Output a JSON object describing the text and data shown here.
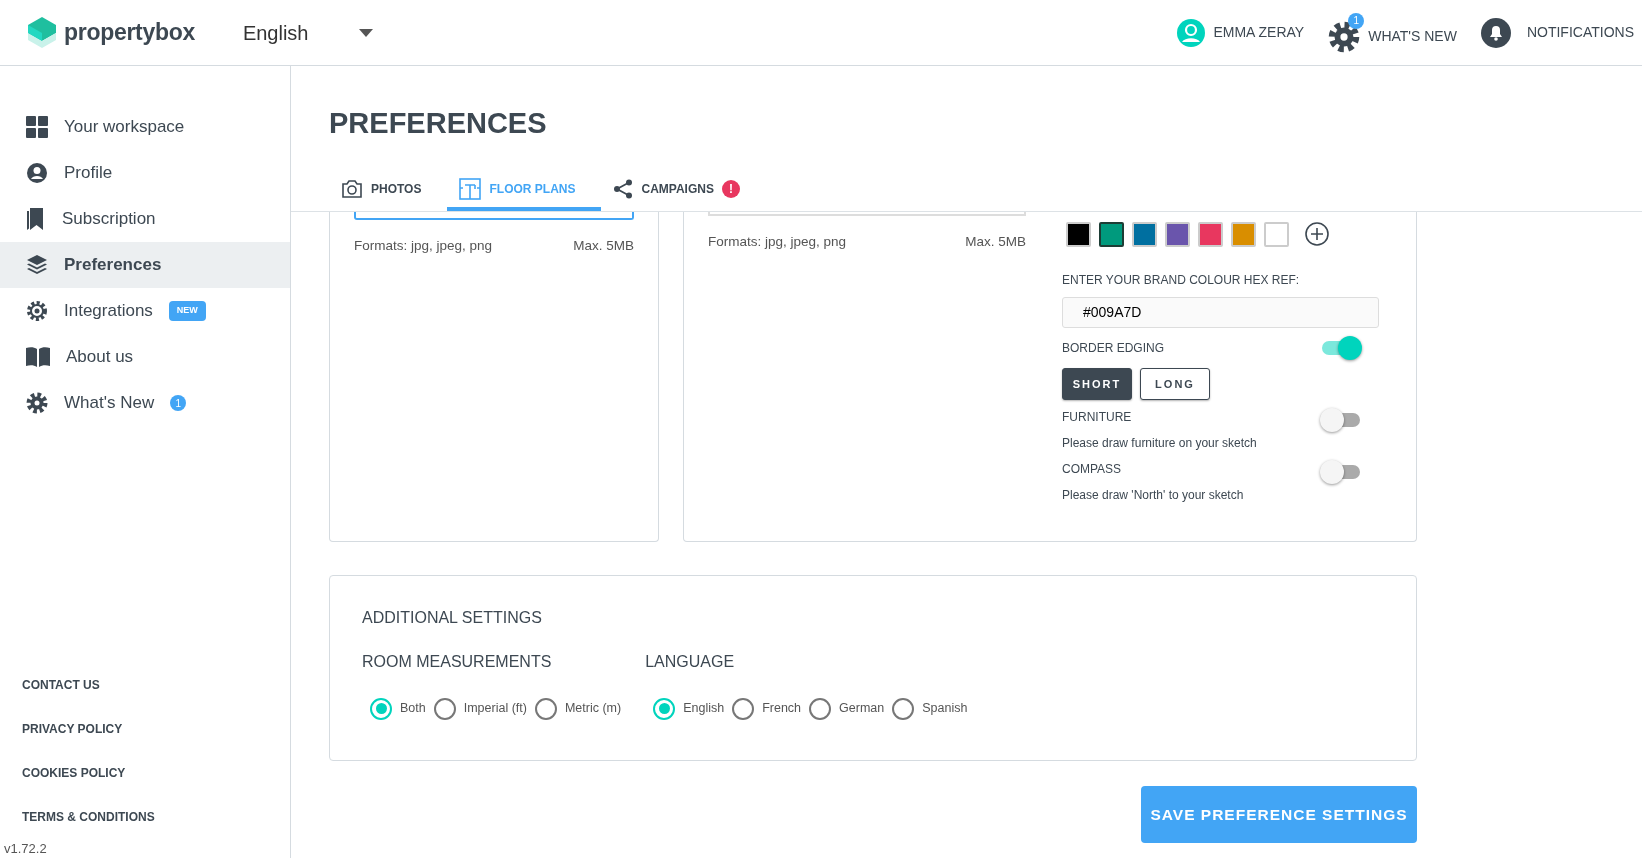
{
  "header": {
    "logo": "propertybox",
    "language": "English",
    "user": "EMMA ZERAY",
    "whats_new": {
      "label": "WHAT'S NEW",
      "badge": "1"
    },
    "notifications": "NOTIFICATIONS"
  },
  "sidebar": {
    "items": [
      {
        "label": "Your workspace",
        "kind": "grid",
        "selected": false
      },
      {
        "label": "Profile",
        "kind": "person",
        "selected": false
      },
      {
        "label": "Subscription",
        "kind": "bookmark",
        "selected": false
      },
      {
        "label": "Preferences",
        "kind": "layers",
        "selected": true
      },
      {
        "label": "Integrations",
        "kind": "cog",
        "selected": false,
        "badge": "NEW"
      },
      {
        "label": "About us",
        "kind": "book",
        "selected": false
      },
      {
        "label": "What's New",
        "kind": "gear",
        "selected": false,
        "count": "1"
      }
    ],
    "footer_links": [
      "CONTACT US",
      "PRIVACY POLICY",
      "COOKIES POLICY",
      "TERMS & CONDITIONS"
    ],
    "version": "v1.72.2"
  },
  "page": {
    "title": "PREFERENCES",
    "tabs": [
      {
        "label": "PHOTOS",
        "kind": "camera",
        "selected": false
      },
      {
        "label": "FLOOR PLANS",
        "kind": "plan",
        "selected": true
      },
      {
        "label": "CAMPAIGNS",
        "kind": "share",
        "selected": false,
        "alert": "!"
      }
    ],
    "left_card": {
      "formats": "Formats: jpg, jpeg, png",
      "max": "Max. 5MB"
    },
    "right_card": {
      "formats": "Formats: jpg, jpeg, png",
      "max": "Max. 5MB",
      "swatches": [
        {
          "color": "#000000",
          "selected": false
        },
        {
          "color": "#009a7d",
          "selected": true
        },
        {
          "color": "#006fa0",
          "selected": false
        },
        {
          "color": "#6a55ac",
          "selected": false
        },
        {
          "color": "#e8375f",
          "selected": false
        },
        {
          "color": "#d98e00",
          "selected": false
        },
        {
          "color": "#ffffff",
          "selected": false
        }
      ],
      "hex_label": "ENTER YOUR BRAND COLOUR HEX REF:",
      "hex_value": "#009A7D",
      "border_edging": {
        "label": "BORDER EDGING",
        "on": true
      },
      "edge_options": [
        {
          "label": "SHORT",
          "selected": true
        },
        {
          "label": "LONG",
          "selected": false
        }
      ],
      "toggles": [
        {
          "label": "FURNITURE",
          "hint": "Please draw furniture on your sketch",
          "on": false
        },
        {
          "label": "COMPASS",
          "hint": "Please draw 'North' to your sketch",
          "on": false
        }
      ]
    },
    "additional": {
      "title": "ADDITIONAL SETTINGS",
      "groups": [
        {
          "title": "ROOM MEASUREMENTS",
          "options": [
            {
              "label": "Both",
              "selected": true
            },
            {
              "label": "Imperial (ft)",
              "selected": false
            },
            {
              "label": "Metric (m)",
              "selected": false
            }
          ]
        },
        {
          "title": "LANGUAGE",
          "options": [
            {
              "label": "English",
              "selected": true
            },
            {
              "label": "French",
              "selected": false
            },
            {
              "label": "German",
              "selected": false
            },
            {
              "label": "Spanish",
              "selected": false
            }
          ]
        }
      ]
    },
    "save_button": "SAVE PREFERENCE SETTINGS"
  }
}
